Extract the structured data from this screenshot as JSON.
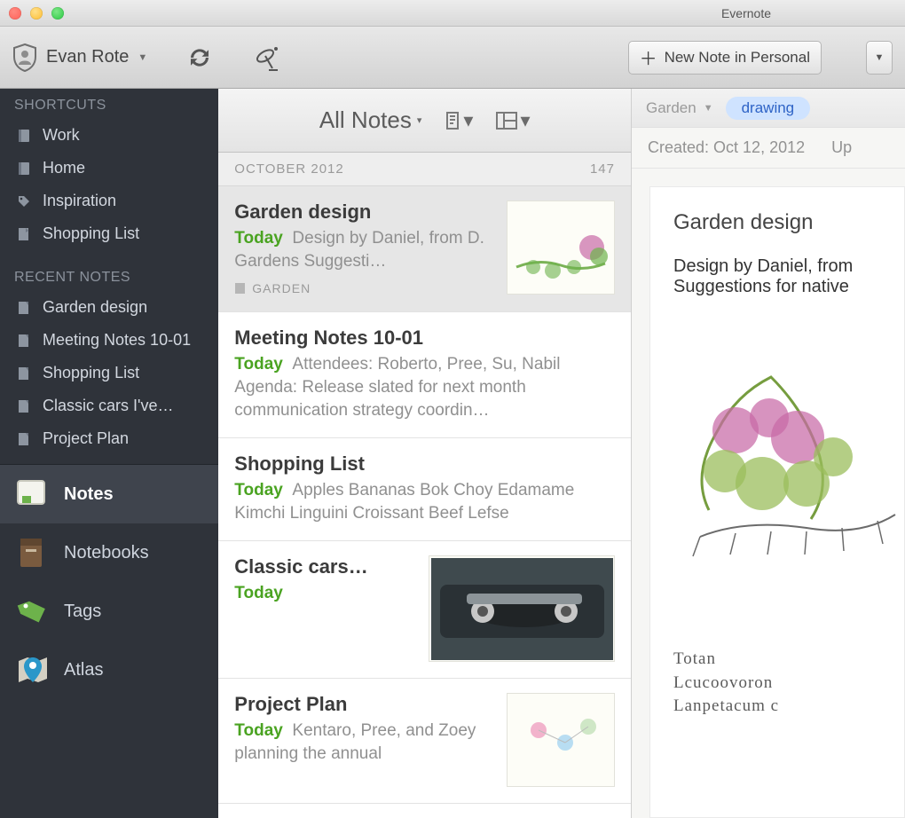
{
  "app_title": "Evernote",
  "toolbar": {
    "account_name": "Evan Rote",
    "new_note_label": "New Note in Personal"
  },
  "sidebar": {
    "shortcuts_header": "SHORTCUTS",
    "shortcuts": [
      {
        "label": "Work",
        "icon": "notebook-icon"
      },
      {
        "label": "Home",
        "icon": "notebook-icon"
      },
      {
        "label": "Inspiration",
        "icon": "tag-icon"
      },
      {
        "label": "Shopping List",
        "icon": "note-icon"
      }
    ],
    "recent_header": "RECENT NOTES",
    "recent": [
      {
        "label": "Garden design"
      },
      {
        "label": "Meeting Notes 10-01"
      },
      {
        "label": "Shopping List"
      },
      {
        "label": "Classic cars I've…"
      },
      {
        "label": "Project Plan"
      }
    ],
    "nav": [
      {
        "label": "Notes",
        "icon": "notes-nav-icon",
        "active": true
      },
      {
        "label": "Notebooks",
        "icon": "notebooks-nav-icon"
      },
      {
        "label": "Tags",
        "icon": "tags-nav-icon"
      },
      {
        "label": "Atlas",
        "icon": "atlas-nav-icon"
      }
    ]
  },
  "notelist": {
    "header_title": "All Notes",
    "month_label": "OCTOBER 2012",
    "month_count": "147",
    "notes": [
      {
        "title": "Garden design",
        "date": "Today",
        "snippet": "Design by Daniel, from D. Gardens Suggesti…",
        "tag": "GARDEN",
        "has_thumb": true,
        "selected": true
      },
      {
        "title": "Meeting Notes 10-01",
        "date": "Today",
        "snippet": "Attendees: Roberto, Pree, Su, Nabil Agenda: Release slated for next month communication strategy coordin…",
        "has_thumb": false
      },
      {
        "title": "Shopping List",
        "date": "Today",
        "snippet": "Apples Bananas Bok Choy Edamame Kimchi Linguini Croissant Beef Lefse",
        "has_thumb": false
      },
      {
        "title": "Classic cars…",
        "date": "Today",
        "snippet": "",
        "has_thumb": true
      },
      {
        "title": "Project Plan",
        "date": "Today",
        "snippet": "Kentaro, Pree, and Zoey planning the annual",
        "has_thumb": true
      }
    ]
  },
  "detail": {
    "notebook": "Garden",
    "tag": "drawing",
    "created_label": "Created: Oct 12, 2012",
    "updated_label": "Up",
    "title": "Garden design",
    "body": "Design by Daniel, from Suggestions for native",
    "hand_lines": "Totan\nLcucoovoron\nLanpetacum c"
  }
}
